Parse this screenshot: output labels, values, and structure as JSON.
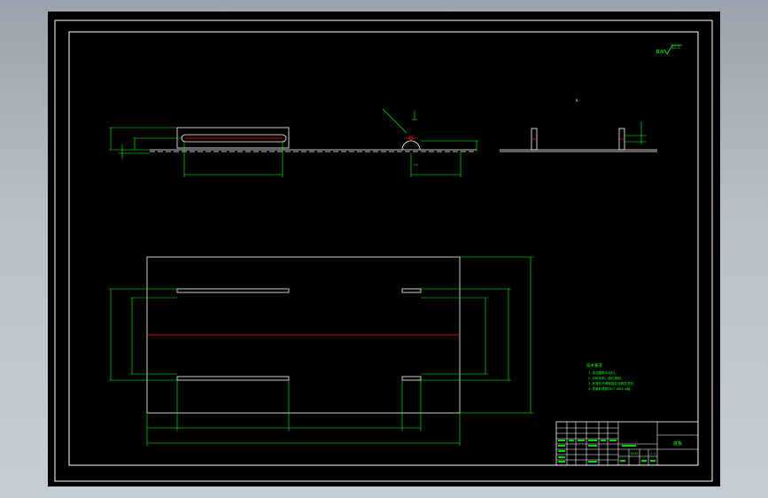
{
  "sheet": {
    "background": "#000000",
    "line_color": "#ffffff",
    "dimension_color": "#00ff00",
    "centerline_color": "#ff0000"
  },
  "surface_finish": {
    "label": "其余",
    "value": "12.5"
  },
  "section_marker": "A",
  "notes": {
    "title": "技术要求",
    "items": [
      "1.未注圆角半径R2。",
      "2.去除毛刺，锐边倒钝。",
      "3.折弯处不得有裂纹及明显变形。",
      "4.表面处理按GB/T1804-m级。"
    ]
  },
  "title_block": {
    "part_name": "底板",
    "scale": "1:1",
    "material": "Q235"
  }
}
